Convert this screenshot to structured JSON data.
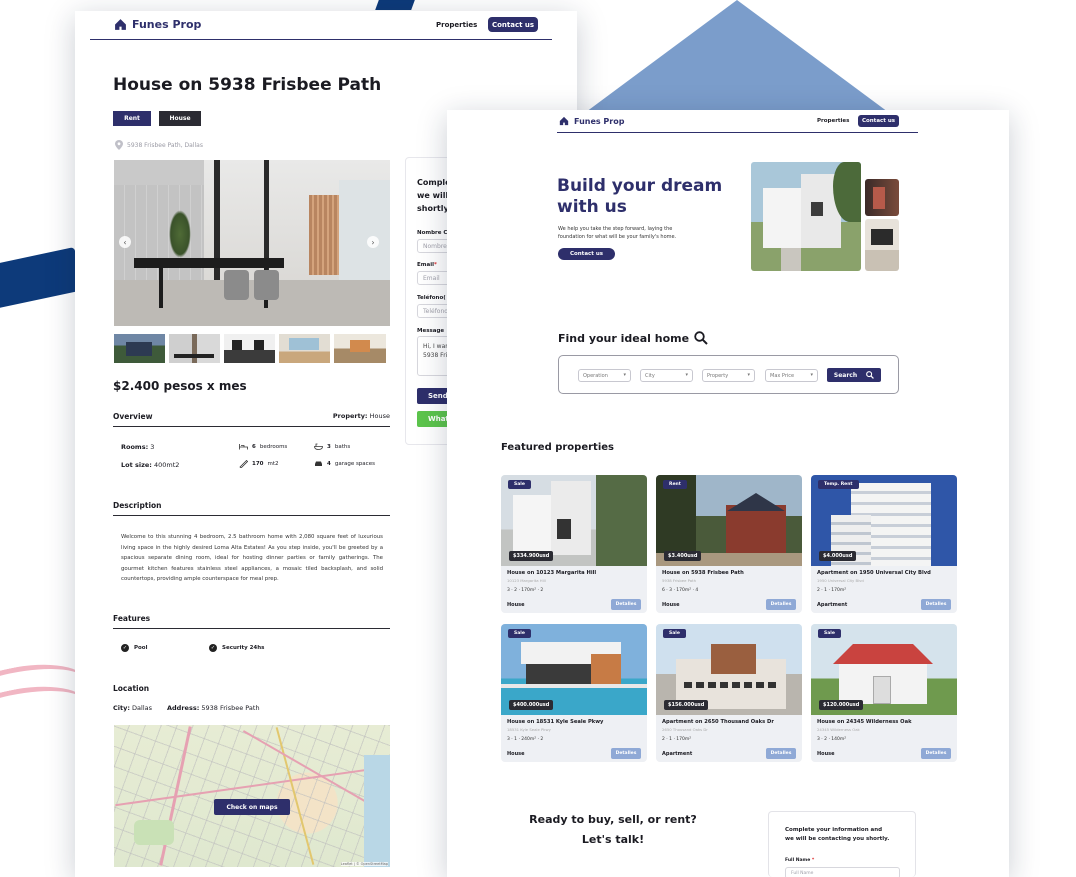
{
  "brand": {
    "name": "Funes Prop",
    "color": "#2e2f6b",
    "accent": "#7b9dcb",
    "green": "#5cc44c"
  },
  "nav": {
    "properties_label": "Properties",
    "contact_label": "Contact us"
  },
  "detail": {
    "title": "House on 5938 Frisbee Path",
    "tags": [
      "Rent",
      "House"
    ],
    "address": "5938 Frisbee Path, Dallas",
    "price": "$2.400 pesos x mes",
    "overview_label": "Overview",
    "property_label": "Property:",
    "property_value": "House",
    "rooms_label": "Rooms:",
    "rooms_value": "3",
    "lot_label": "Lot size:",
    "lot_value": "400mt2",
    "stats": [
      {
        "icon": "bed-icon",
        "value": "6",
        "label": "bedrooms"
      },
      {
        "icon": "bath-icon",
        "value": "3",
        "label": "baths"
      },
      {
        "icon": "ruler-icon",
        "value": "170",
        "label": "mt2"
      },
      {
        "icon": "car-icon",
        "value": "4",
        "label": "garage spaces"
      }
    ],
    "description_label": "Description",
    "description": "Welcome to this stunning 4 bedroom, 2.5 bathroom home with 2,080 square feet of luxurious living space in the highly desired Loma Alta Estates! As you step inside, you'll be greeted by a spacious separate dining room, ideal for hosting dinner parties or family gatherings. The gourmet kitchen features stainless steel appliances, a mosaic tiled backsplash, and solid countertops, providing ample counterspace for meal prep.",
    "features_label": "Features",
    "features": [
      "Pool",
      "Security 24hs"
    ],
    "location_label": "Location",
    "city_label": "City:",
    "city_value": "Dallas",
    "address_label": "Address:",
    "address_value": "5938 Frisbee Path",
    "maps_button": "Check on maps",
    "map_credit": "Leaflet | © OpenStreetMap",
    "form": {
      "heading_line1": "Comple",
      "heading_line2": "we will",
      "heading_line3": "shortly",
      "name_label": "Nombre C",
      "name_placeholder": "Nombre",
      "email_label": "Email",
      "email_placeholder": "Email",
      "phone_label": "Teléfono(",
      "phone_placeholder": "Teléfono",
      "message_label": "Message",
      "message_line1": "Hi, I want",
      "message_line2": "5938 Fris",
      "send_label": "Send",
      "whatsapp_label": "What"
    }
  },
  "home": {
    "hero_title_line1": "Build your dream",
    "hero_title_line2": "with us",
    "hero_text_line1": "We help you take the step forward, laying the",
    "hero_text_line2": "foundation for what will be your family's home.",
    "hero_button": "Contact us",
    "search_title": "Find your ideal home",
    "filters": [
      "Operation",
      "City",
      "Property",
      "Max Price"
    ],
    "search_button": "Search",
    "featured_title": "Featured properties",
    "details_label": "Detalles",
    "cards": [
      {
        "badge": "Sale",
        "price": "$334.900usd",
        "title": "House on 10123 Margarita Hill",
        "address": "10123 Margarita Hill",
        "features": "3 · 2 · 170m² · 2",
        "type": "House"
      },
      {
        "badge": "Rent",
        "price": "$3.400usd",
        "title": "House on 5938 Frisbee Path",
        "address": "5938 Frisbee Path",
        "features": "6 · 3 · 170m² · 4",
        "type": "House"
      },
      {
        "badge": "Temp. Rent",
        "price": "$4.000usd",
        "title": "Apartment on 1950 Universal City Blvd",
        "address": "1950 Universal City Blvd",
        "features": "2 · 1 · 170m²",
        "type": "Apartment"
      },
      {
        "badge": "Sale",
        "price": "$400.000usd",
        "title": "House on 18531 Kyle Seale Pkwy",
        "address": "18531 Kyle Seale Pkwy",
        "features": "3 · 1 · 240m² · 2",
        "type": "House"
      },
      {
        "badge": "Sale",
        "price": "$156.000usd",
        "title": "Apartment on 2650 Thousand Oaks Dr",
        "address": "2650 Thousand Oaks Dr",
        "features": "2 · 1 · 170m²",
        "type": "Apartment"
      },
      {
        "badge": "Sale",
        "price": "$120.000usd",
        "title": "House on 24345 Wilderness Oak",
        "address": "24345 Wilderness Oak",
        "features": "3 · 2 · 140m²",
        "type": "House"
      }
    ],
    "cta_line1": "Ready to buy, sell, or rent?",
    "cta_line2": "Let's talk!",
    "form_heading_line1": "Complete your information and",
    "form_heading_line2": "we will be contacting you shortly.",
    "form_name_label": "Full Name",
    "form_name_placeholder": "Full Name"
  }
}
